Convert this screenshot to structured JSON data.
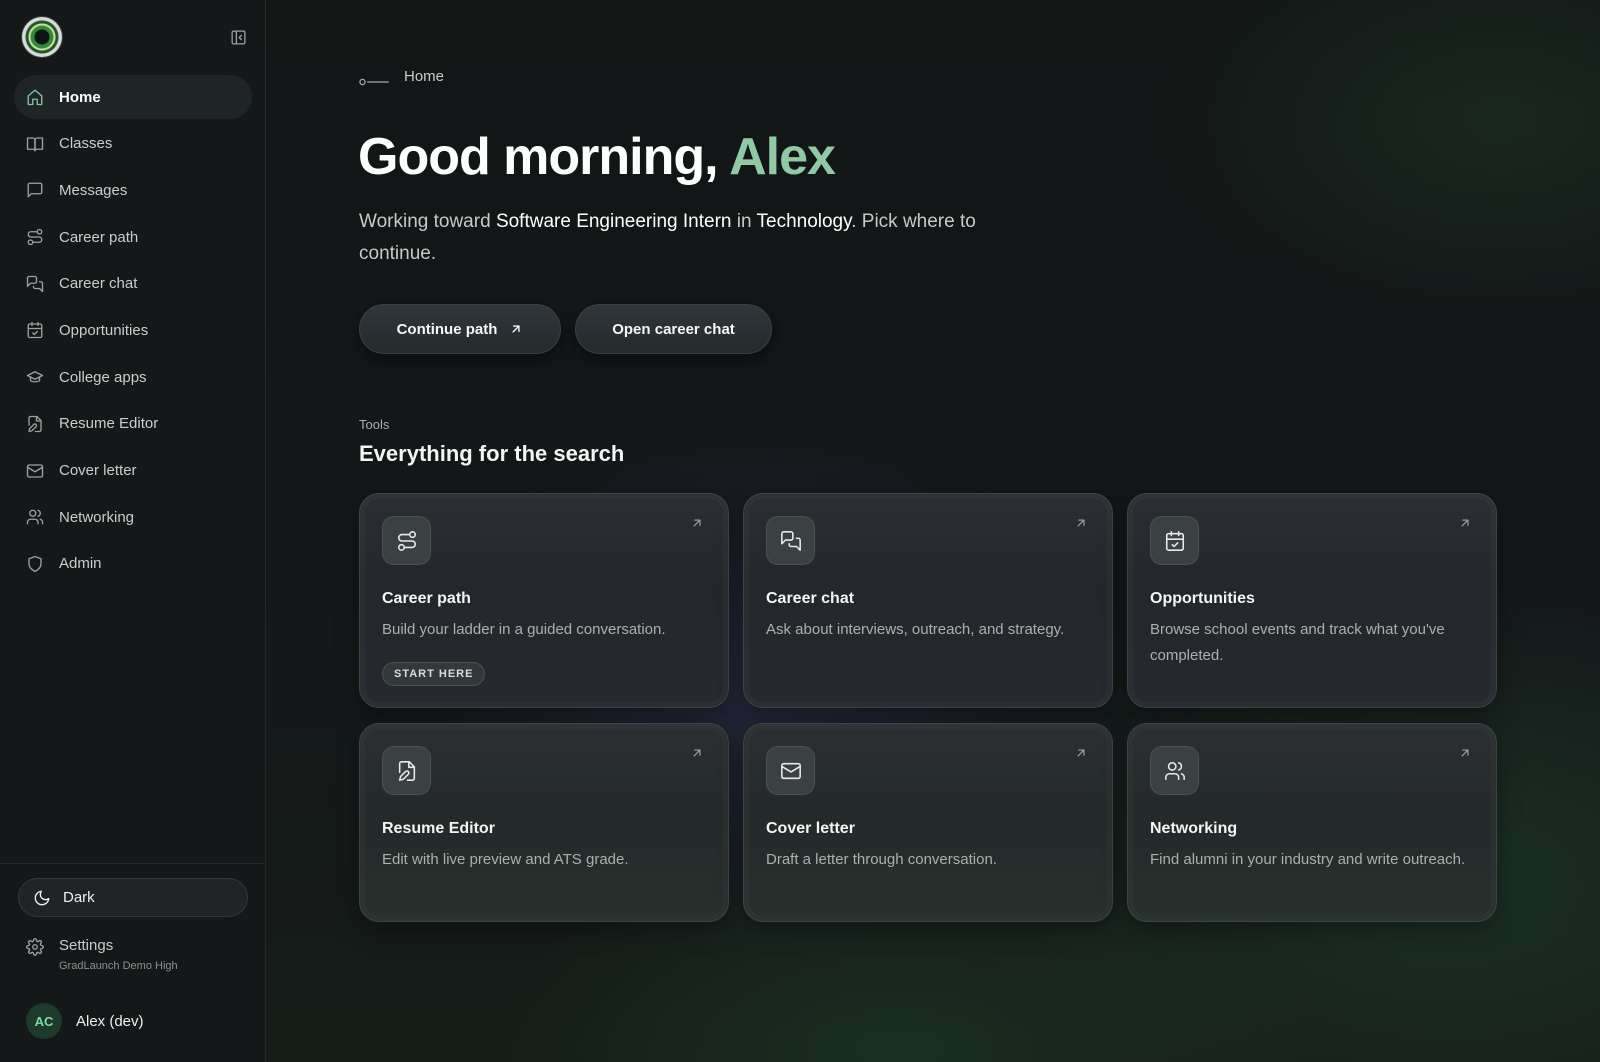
{
  "sidebar": {
    "items": [
      {
        "label": "Home",
        "icon": "home-icon"
      },
      {
        "label": "Classes",
        "icon": "book-icon"
      },
      {
        "label": "Messages",
        "icon": "message-icon"
      },
      {
        "label": "Career path",
        "icon": "route-icon"
      },
      {
        "label": "Career chat",
        "icon": "chat-icon"
      },
      {
        "label": "Opportunities",
        "icon": "calendar-check-icon"
      },
      {
        "label": "College apps",
        "icon": "graduation-cap-icon"
      },
      {
        "label": "Resume Editor",
        "icon": "file-edit-icon"
      },
      {
        "label": "Cover letter",
        "icon": "mail-icon"
      },
      {
        "label": "Networking",
        "icon": "users-icon"
      },
      {
        "label": "Admin",
        "icon": "shield-icon"
      }
    ],
    "theme_label": "Dark",
    "settings_label": "Settings",
    "org_name": "GradLaunch Demo High",
    "user_initials": "AC",
    "user_name": "Alex (dev)"
  },
  "main": {
    "breadcrumb": "Home",
    "greeting_prefix": "Good morning, ",
    "greeting_name": "Alex",
    "subtitle": {
      "t1": "Working toward ",
      "role": "Software Engineering Intern",
      "t2": " in ",
      "field": "Technology",
      "t3": ". Pick where to continue."
    },
    "continue_button": "Continue path",
    "chat_button": "Open career chat",
    "section_eyebrow": "Tools",
    "section_title": "Everything for the search",
    "cards": [
      {
        "title": "Career path",
        "desc": "Build your ladder in a guided conversation.",
        "badge": "START HERE",
        "icon": "route-icon"
      },
      {
        "title": "Career chat",
        "desc": "Ask about interviews, outreach, and strategy.",
        "icon": "chat-icon"
      },
      {
        "title": "Opportunities",
        "desc": "Browse school events and track what you've completed.",
        "icon": "calendar-check-icon"
      },
      {
        "title": "Resume Editor",
        "desc": "Edit with live preview and ATS grade.",
        "icon": "file-edit-icon"
      },
      {
        "title": "Cover letter",
        "desc": "Draft a letter through conversation.",
        "icon": "mail-icon"
      },
      {
        "title": "Networking",
        "desc": "Find alumni in your industry and write outreach.",
        "icon": "users-icon"
      }
    ]
  },
  "colors": {
    "accent": "#8fc9a6",
    "background": "#0f1313",
    "sidebar": "#141818"
  }
}
